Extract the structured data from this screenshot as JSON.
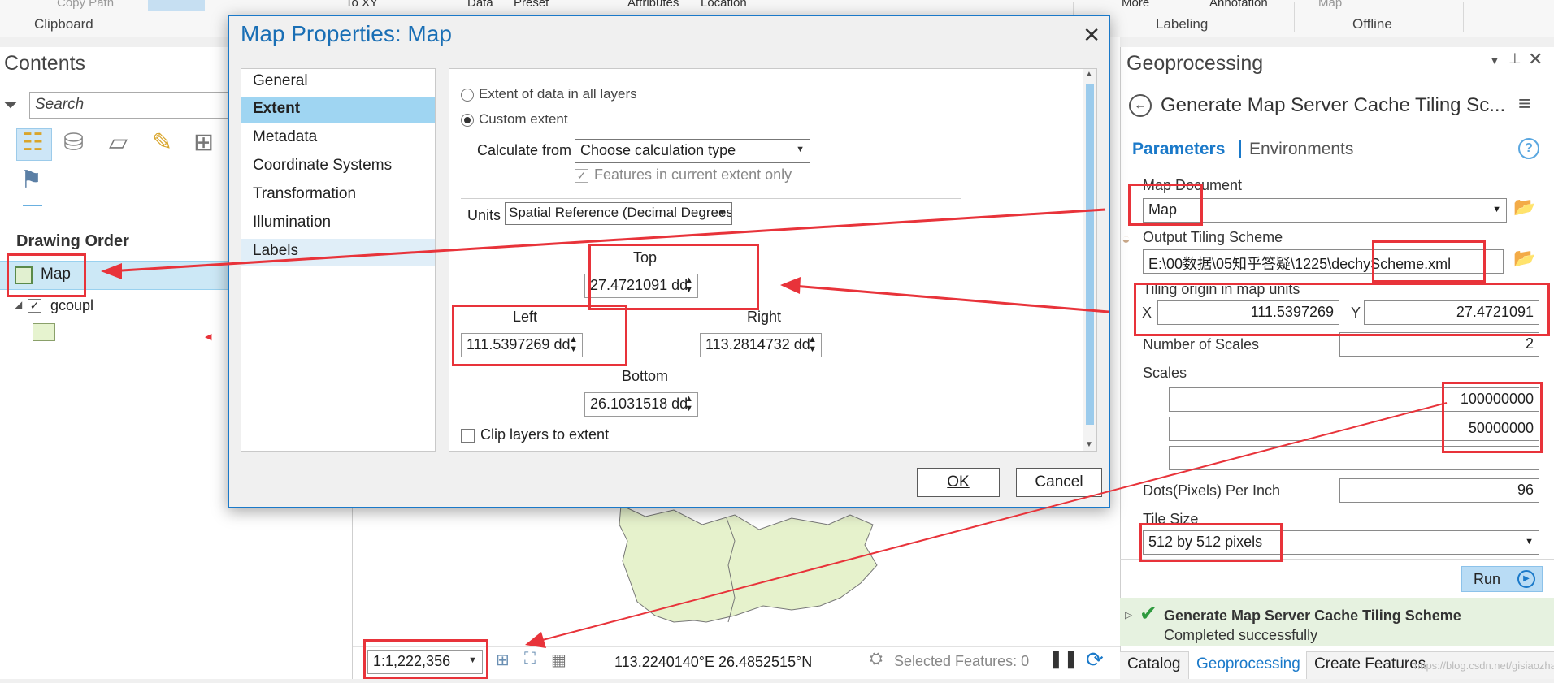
{
  "ribbon": {
    "copy_path": "Copy Path",
    "to_xy": "To XY",
    "data": "Data",
    "preset": "Preset",
    "attributes": "Attributes",
    "location": "Location",
    "more": "More",
    "annotation": "Annotation",
    "map": "Map",
    "groups": {
      "clipboard": "Clipboard",
      "labeling": "Labeling",
      "offline": "Offline"
    }
  },
  "contents": {
    "title": "Contents",
    "search_placeholder": "Search",
    "drawing_order": "Drawing Order",
    "map_layer": "Map",
    "layer": "gcoupl"
  },
  "dialog": {
    "title": "Map Properties: Map",
    "nav": [
      "General",
      "Extent",
      "Metadata",
      "Coordinate Systems",
      "Transformation",
      "Illumination",
      "Labels"
    ],
    "extent": {
      "option_all": "Extent of data in all layers",
      "option_custom": "Custom extent",
      "calc_label": "Calculate from",
      "calc_value": "Choose calculation type",
      "features_current": "Features in current extent only",
      "units_label": "Units",
      "units_value": "Spatial Reference (Decimal Degrees)",
      "top_label": "Top",
      "top_value": "27.4721091 dd",
      "left_label": "Left",
      "left_value": "111.5397269 dd",
      "right_label": "Right",
      "right_value": "113.2814732 dd",
      "bottom_label": "Bottom",
      "bottom_value": "26.1031518 dd",
      "clip": "Clip layers to extent"
    },
    "ok": "OK",
    "cancel": "Cancel"
  },
  "geoprocessing": {
    "title": "Geoprocessing",
    "tool_title": "Generate Map Server Cache Tiling Sc...",
    "tab_parameters": "Parameters",
    "tab_environments": "Environments",
    "map_document_label": "Map Document",
    "map_document_value": "Map",
    "output_label": "Output Tiling Scheme",
    "output_value": "E:\\00数据\\05知乎答疑\\1225\\dechyScheme.xml",
    "origin_label": "Tiling origin in map units",
    "x_label": "X",
    "x_value": "111.5397269",
    "y_label": "Y",
    "y_value": "27.4721091",
    "num_scales_label": "Number of Scales",
    "num_scales_value": "2",
    "scales_label": "Scales",
    "scales": [
      "100000000",
      "50000000",
      ""
    ],
    "dpi_label": "Dots(Pixels) Per Inch",
    "dpi_value": "96",
    "tile_size_label": "Tile Size",
    "tile_size_value": "512 by 512 pixels",
    "run": "Run",
    "msg_title": "Generate Map Server Cache Tiling Scheme",
    "msg_status": "Completed successfully",
    "bottom_tabs": [
      "Catalog",
      "Geoprocessing",
      "Create Features"
    ],
    "watermark": "https://blog.csdn.net/gisiaozhang"
  },
  "status": {
    "scale": "1:1,222,356",
    "coords": "113.2240140°E 26.4852515°N",
    "selected": "Selected Features: 0"
  }
}
